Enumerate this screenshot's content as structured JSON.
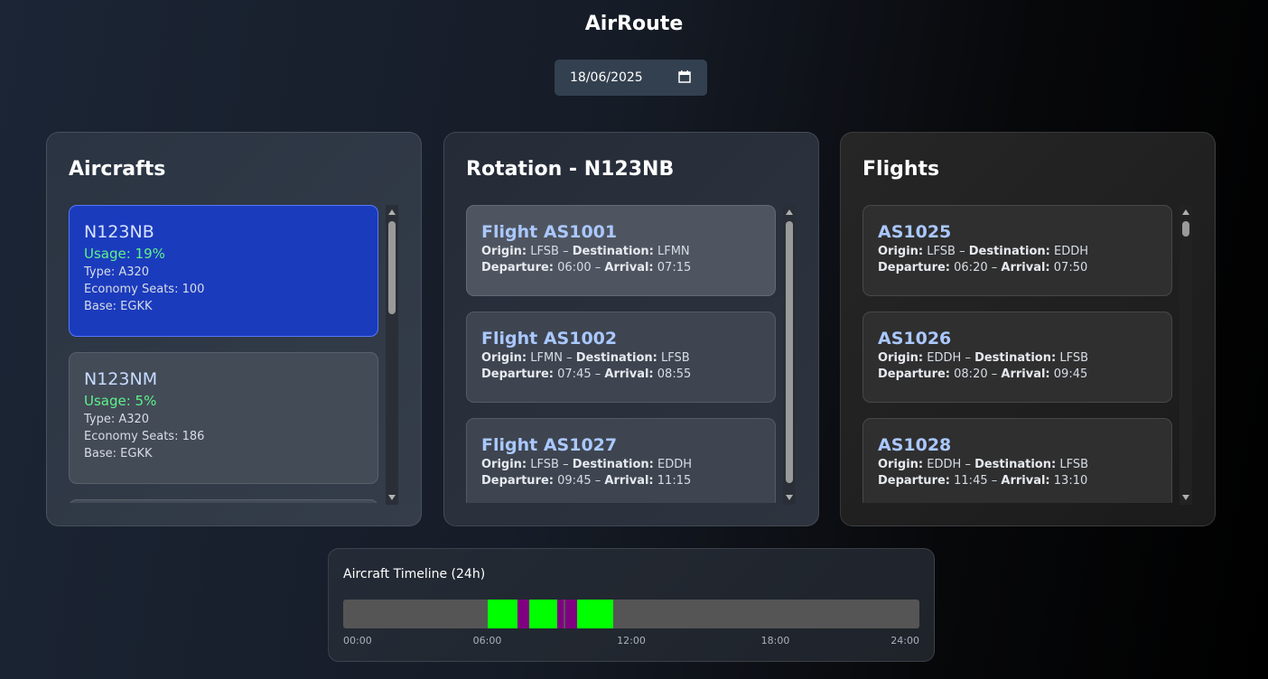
{
  "app": {
    "title": "AirRoute"
  },
  "date_picker": {
    "value": "18/06/2025"
  },
  "aircraft_panel": {
    "title": "Aircrafts",
    "items": [
      {
        "reg": "N123NB",
        "usage": "Usage: 19%",
        "type": "Type: A320",
        "seats": "Economy Seats: 100",
        "base": "Base: EGKK",
        "selected": true
      },
      {
        "reg": "N123NM",
        "usage": "Usage: 5%",
        "type": "Type: A320",
        "seats": "Economy Seats: 186",
        "base": "Base: EGKK",
        "selected": false
      }
    ]
  },
  "rotation_panel": {
    "title": "Rotation - N123NB",
    "labels": {
      "origin": "Origin:",
      "destination": "Destination:",
      "departure": "Departure:",
      "arrival": "Arrival:",
      "separator": "–"
    },
    "items": [
      {
        "title": "Flight AS1001",
        "origin": "LFSB",
        "destination": "LFMN",
        "departure": "06:00",
        "arrival": "07:15"
      },
      {
        "title": "Flight AS1002",
        "origin": "LFMN",
        "destination": "LFSB",
        "departure": "07:45",
        "arrival": "08:55"
      },
      {
        "title": "Flight AS1027",
        "origin": "LFSB",
        "destination": "EDDH",
        "departure": "09:45",
        "arrival": "11:15"
      }
    ]
  },
  "flights_panel": {
    "title": "Flights",
    "items": [
      {
        "title": "AS1025",
        "origin": "LFSB",
        "destination": "EDDH",
        "departure": "06:20",
        "arrival": "07:50"
      },
      {
        "title": "AS1026",
        "origin": "EDDH",
        "destination": "LFSB",
        "departure": "08:20",
        "arrival": "09:45"
      },
      {
        "title": "AS1028",
        "origin": "EDDH",
        "destination": "LFSB",
        "departure": "11:45",
        "arrival": "13:10"
      }
    ]
  },
  "timeline": {
    "title": "Aircraft Timeline (24h)",
    "range_hours": [
      0,
      24
    ],
    "ticks": [
      "00:00",
      "06:00",
      "12:00",
      "18:00",
      "24:00"
    ],
    "colors": {
      "flight": "#00ff00",
      "turnaround": "#800080",
      "idle": "#555555"
    },
    "segments": [
      {
        "kind": "flight",
        "start": 6.0,
        "end": 7.25
      },
      {
        "kind": "turnaround",
        "start": 7.25,
        "end": 7.75
      },
      {
        "kind": "flight",
        "start": 7.75,
        "end": 8.9167
      },
      {
        "kind": "turnaround",
        "start": 8.9167,
        "end": 9.1667
      },
      {
        "kind": "turnaround",
        "start": 9.25,
        "end": 9.75
      },
      {
        "kind": "flight",
        "start": 9.75,
        "end": 11.25
      }
    ]
  }
}
